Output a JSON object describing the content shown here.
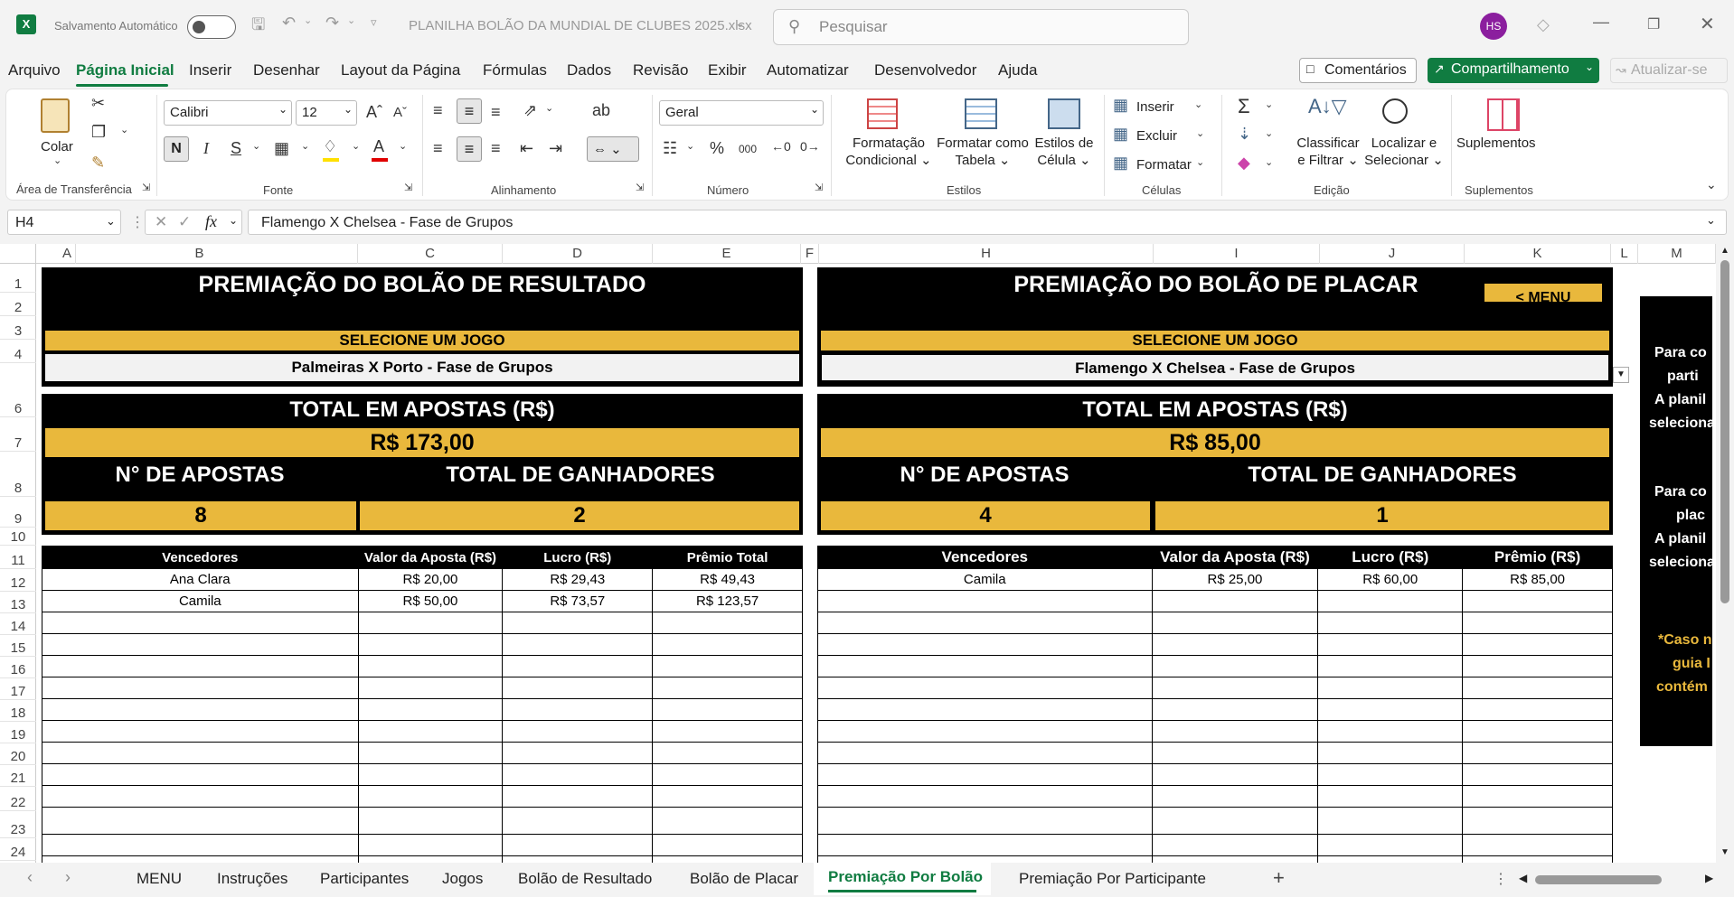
{
  "titlebar": {
    "autosave_label": "Salvamento Automático",
    "filename": "PLANILHA BOLÃO DA MUNDIAL DE CLUBES 2025.xlsx",
    "search_placeholder": "Pesquisar",
    "avatar_initials": "HS"
  },
  "menu_tabs": [
    "Arquivo",
    "Página Inicial",
    "Inserir",
    "Desenhar",
    "Layout da Página",
    "Fórmulas",
    "Dados",
    "Revisão",
    "Exibir",
    "Automatizar",
    "Desenvolvedor",
    "Ajuda"
  ],
  "menu_buttons": {
    "comments": "Comentários",
    "share": "Compartilhamento",
    "update": "Atualizar-se"
  },
  "ribbon": {
    "clipboard": {
      "paste": "Colar",
      "label": "Área de Transferência"
    },
    "font": {
      "name": "Calibri",
      "size": "12",
      "bold": "N",
      "italic": "I",
      "underline": "S",
      "label": "Fonte"
    },
    "alignment": {
      "label": "Alinhamento"
    },
    "number": {
      "format": "Geral",
      "label": "Número",
      "percent": "%",
      "thousands": "000"
    },
    "styles": {
      "cond_format_1": "Formatação",
      "cond_format_2": "Condicional",
      "table_1": "Formatar como",
      "table_2": "Tabela",
      "cell_1": "Estilos de",
      "cell_2": "Célula",
      "label": "Estilos"
    },
    "cells": {
      "insert": "Inserir",
      "delete": "Excluir",
      "format": "Formatar",
      "label": "Células"
    },
    "editing": {
      "sort_1": "Classificar",
      "sort_2": "e Filtrar",
      "find_1": "Localizar e",
      "find_2": "Selecionar",
      "label": "Edição"
    },
    "addins": {
      "addins": "Suplementos",
      "label": "Suplementos"
    }
  },
  "formula_bar": {
    "cell_ref": "H4",
    "formula": "Flamengo X Chelsea - Fase de Grupos"
  },
  "columns": [
    "A",
    "B",
    "C",
    "D",
    "E",
    "F",
    "H",
    "I",
    "J",
    "K",
    "L",
    "M"
  ],
  "rows": [
    "1",
    "2",
    "3",
    "4",
    "6",
    "7",
    "8",
    "9",
    "10",
    "11",
    "12",
    "13",
    "14",
    "15",
    "16",
    "17",
    "18",
    "19",
    "20",
    "21",
    "22",
    "23",
    "24"
  ],
  "left_panel": {
    "title": "PREMIAÇÃO DO BOLÃO DE RESULTADO",
    "select_label": "SELECIONE UM JOGO",
    "selected_game": "Palmeiras X Porto - Fase de Grupos",
    "total_label": "TOTAL EM APOSTAS (R$)",
    "total_value": "R$ 173,00",
    "bets_label": "N° DE APOSTAS",
    "winners_label": "TOTAL DE GANHADORES",
    "bets_value": "8",
    "winners_value": "2",
    "headers": [
      "Vencedores",
      "Valor da Aposta (R$)",
      "Lucro (R$)",
      "Prêmio Total"
    ],
    "rows": [
      [
        "Ana Clara",
        "R$ 20,00",
        "R$ 29,43",
        "R$ 49,43"
      ],
      [
        "Camila",
        "R$ 50,00",
        "R$ 73,57",
        "R$ 123,57"
      ]
    ]
  },
  "right_panel": {
    "title": "PREMIAÇÃO DO BOLÃO DE PLACAR",
    "menu_button": "< MENU",
    "select_label": "SELECIONE UM JOGO",
    "selected_game": "Flamengo X Chelsea - Fase de Grupos",
    "total_label": "TOTAL EM APOSTAS (R$)",
    "total_value": "R$ 85,00",
    "bets_label": "N° DE APOSTAS",
    "winners_label": "TOTAL DE GANHADORES",
    "bets_value": "4",
    "winners_value": "1",
    "headers": [
      "Vencedores",
      "Valor da Aposta (R$)",
      "Lucro (R$)",
      "Prêmio (R$)"
    ],
    "rows": [
      [
        "Camila",
        "R$ 25,00",
        "R$ 60,00",
        "R$ 85,00"
      ]
    ]
  },
  "side_note": {
    "lines1": [
      "Para co",
      "parti",
      "A planil",
      "seleciona"
    ],
    "lines2": [
      "Para co",
      "plac",
      "A planil",
      "seleciona"
    ],
    "lines3": [
      "*Caso n",
      "guia I",
      "contém"
    ]
  },
  "sheet_tabs": [
    "MENU",
    "Instruções",
    "Participantes",
    "Jogos",
    "Bolão de Resultado",
    "Bolão de Placar",
    "Premiação Por Bolão",
    "Premiação Por Participante"
  ],
  "active_sheet": "Premiação Por Bolão",
  "colors": {
    "accent_green": "#107c41",
    "gold": "#e9b83c",
    "black": "#000000",
    "avatar": "#8b1e9e"
  }
}
